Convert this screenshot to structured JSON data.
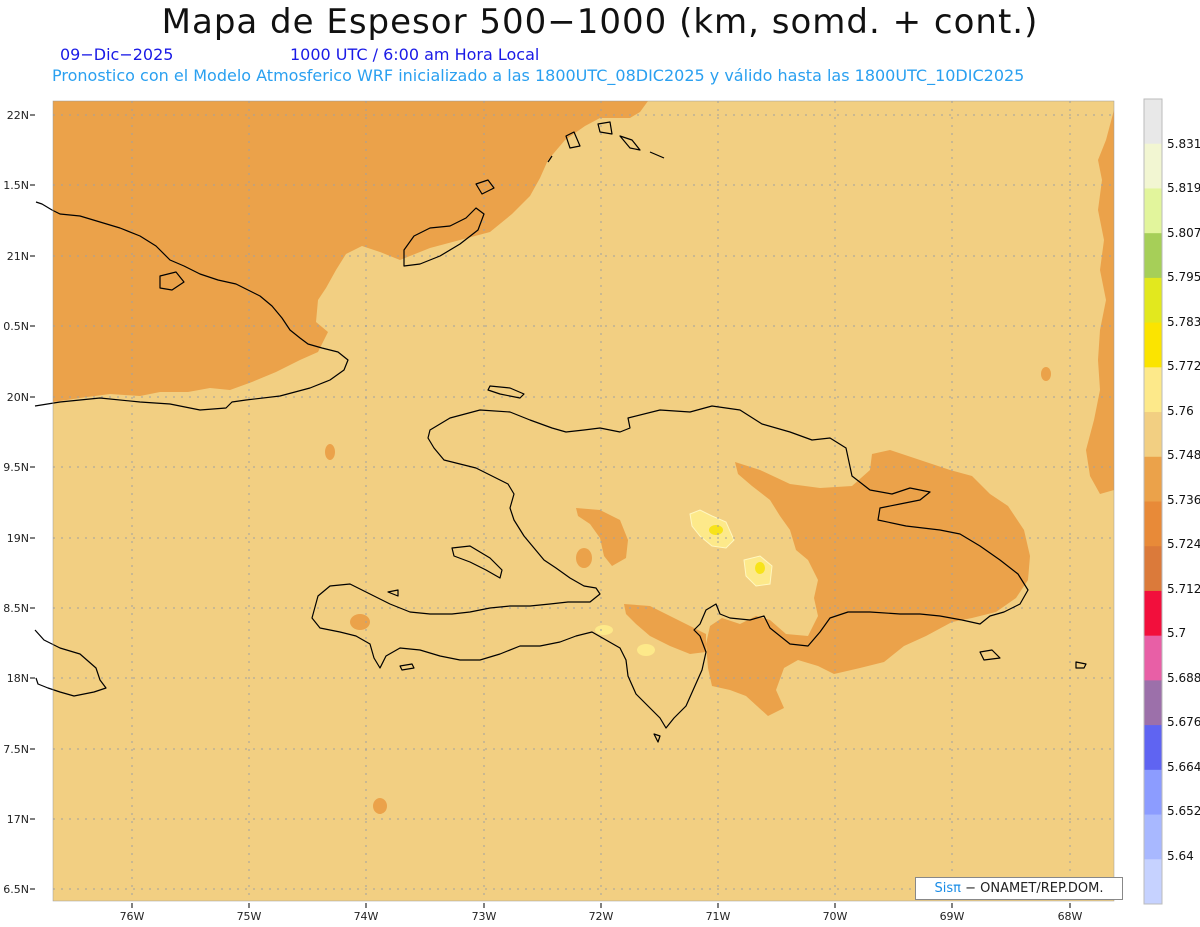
{
  "header": {
    "title": "Mapa de Espesor 500−1000 (km, somd. + cont.)",
    "date": "09−Dic−2025",
    "time": "1000 UTC / 6:00 am Hora Local",
    "description": "Pronostico con el Modelo Atmosferico WRF inicializado a las 1800UTC_08DIC2025 y válido hasta las  1800UTC_10DIC2025"
  },
  "map": {
    "lat_labels": [
      "22N",
      "1.5N",
      "21N",
      "0.5N",
      "20N",
      "9.5N",
      "19N",
      "8.5N",
      "18N",
      "7.5N",
      "17N",
      "6.5N"
    ],
    "lon_labels": [
      "76W",
      "75W",
      "74W",
      "73W",
      "72W",
      "71W",
      "70W",
      "69W",
      "68W"
    ],
    "colors": {
      "background_field": "#f2cf82",
      "low_field": "#eba24a",
      "high_field": "#fde98a",
      "peak_field": "#f7e31a",
      "coast": "#000000",
      "grid": "#a0a0a0"
    }
  },
  "legend": {
    "labels": [
      "5.831",
      "5.819",
      "5.807",
      "5.795",
      "5.783",
      "5.772",
      "5.76",
      "5.748",
      "5.736",
      "5.724",
      "5.712",
      "5.7",
      "5.688",
      "5.676",
      "5.664",
      "5.652",
      "5.64"
    ],
    "colors": [
      "#e8e8e8",
      "#f2f6d2",
      "#e2f59c",
      "#a6cf58",
      "#e2e81e",
      "#fbe400",
      "#fde98a",
      "#f2cf82",
      "#eba24a",
      "#e88a38",
      "#db7a3a",
      "#f20f3c",
      "#e85fa6",
      "#9c70aa",
      "#5f64f2",
      "#8c9cff",
      "#a8b8ff",
      "#c6d2ff"
    ]
  },
  "credit": {
    "brand": "Sis",
    "pi": "π",
    "org": "− ONAMET/REP.DOM."
  }
}
